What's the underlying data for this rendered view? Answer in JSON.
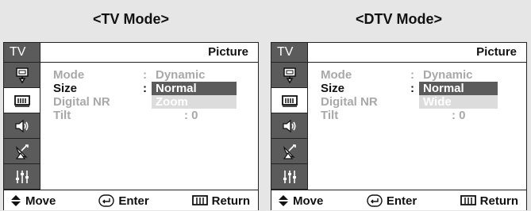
{
  "captions": {
    "left": "<TV Mode>",
    "right": "<DTV Mode>"
  },
  "tv_mode": {
    "tab": "TV",
    "header": "Picture",
    "menu": {
      "mode_label": "Mode",
      "mode_colon": ":",
      "mode_value": "Dynamic",
      "size_label": "Size",
      "size_colon": ":",
      "size_selected": "Normal",
      "size_next": "Zoom",
      "dnr_label": "Digital NR",
      "tilt_label": "Tilt",
      "tilt_value": ": 0"
    },
    "footer": {
      "move": "Move",
      "enter": "Enter",
      "return": "Return"
    }
  },
  "dtv_mode": {
    "tab": "TV",
    "header": "Picture",
    "menu": {
      "mode_label": "Mode",
      "mode_colon": ":",
      "mode_value": "Dynamic",
      "size_label": "Size",
      "size_colon": ":",
      "size_selected": "Normal",
      "size_next": "Wide",
      "dnr_label": "Digital NR",
      "tilt_label": "Tilt",
      "tilt_value": ": 0"
    },
    "footer": {
      "move": "Move",
      "enter": "Enter",
      "return": "Return"
    }
  },
  "icons": [
    "input-icon",
    "picture-icon",
    "sound-icon",
    "channel-icon",
    "setup-icon"
  ],
  "colors": {
    "panel_dark": "#5b5b5b",
    "dim_text": "#a8a8a8",
    "option_bg": "#dcdcdc"
  }
}
